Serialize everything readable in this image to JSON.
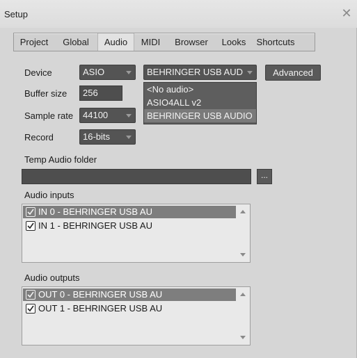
{
  "window": {
    "title": "Setup",
    "close_glyph": "✕"
  },
  "tabs": [
    {
      "label": "Project"
    },
    {
      "label": "Global"
    },
    {
      "label": "Audio",
      "active": true
    },
    {
      "label": "MIDI"
    },
    {
      "label": "Browser"
    },
    {
      "label": "Looks"
    },
    {
      "label": "Shortcuts"
    }
  ],
  "audio": {
    "device_label": "Device",
    "device_type": "ASIO",
    "device_name": "BEHRINGER USB AUD",
    "advanced_label": "Advanced",
    "buffer_label": "Buffer size",
    "buffer_value": "256",
    "samplerate_label": "Sample rate",
    "samplerate_value": "44100",
    "record_label": "Record",
    "record_value": "16-bits",
    "device_options": [
      "<No audio>",
      "ASIO4ALL v2",
      "BEHRINGER USB AUDIO"
    ],
    "device_options_selected": 2,
    "temp_folder_label": "Temp Audio folder",
    "temp_folder_value": "",
    "browse_label": "...",
    "inputs_label": "Audio inputs",
    "inputs": [
      {
        "label": "IN 0 - BEHRINGER USB AU",
        "checked": true,
        "highlighted": true
      },
      {
        "label": "IN 1 - BEHRINGER USB AU",
        "checked": true,
        "highlighted": false
      }
    ],
    "outputs_label": "Audio outputs",
    "outputs": [
      {
        "label": "OUT 0 - BEHRINGER USB AU",
        "checked": true,
        "highlighted": true
      },
      {
        "label": "OUT 1 - BEHRINGER USB AU",
        "checked": true,
        "highlighted": false
      }
    ]
  },
  "colors": {
    "panel_bg": "#d6d6d6",
    "control_dark": "#545454",
    "highlight": "#7e7e7e"
  }
}
